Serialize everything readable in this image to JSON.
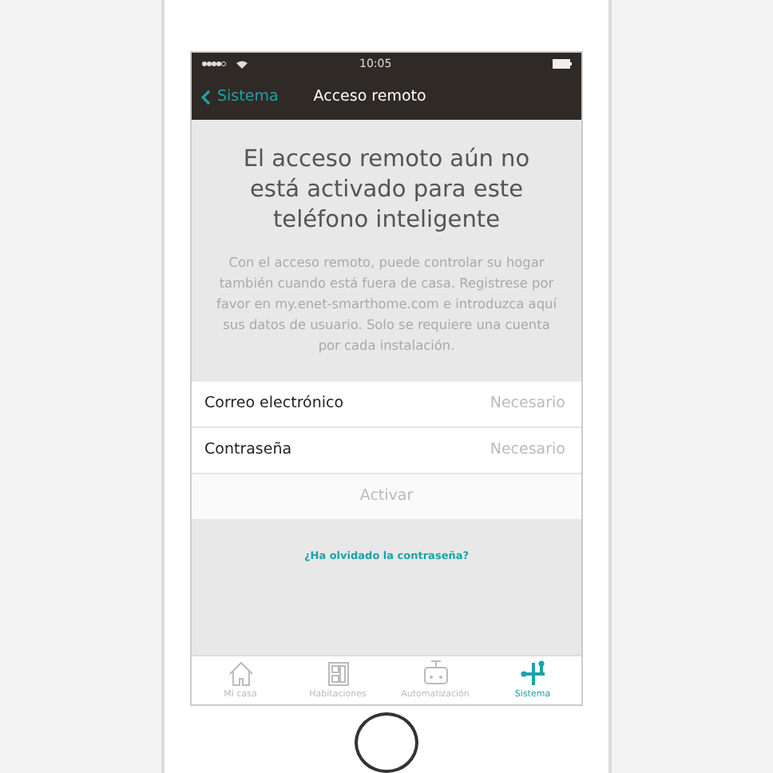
{
  "status_bar": {
    "time": "10:05"
  },
  "nav": {
    "back": "Sistema",
    "title": "Acceso remoto"
  },
  "heading": "El acceso remoto aún no está activado para este teléfono inteligente",
  "body": "Con el acceso remoto, puede controlar su hogar también cuando está fuera de casa. Registrese por favor en my.enet-smarthome.com e introduzca aquí sus datos de usuario. Solo se requiere una cuenta por cada instalación.",
  "fields": [
    {
      "label": "Correo electrónico",
      "placeholder": "Necesario"
    },
    {
      "label": "Contraseña",
      "placeholder": "Necesario"
    }
  ],
  "button": "Activar",
  "link": "¿Ha olvidado la contraseña?",
  "tabs": [
    {
      "kind": "home",
      "label": "Mi casa",
      "selected": false
    },
    {
      "kind": "rooms",
      "label": "Habitaciones",
      "selected": false
    },
    {
      "kind": "automation",
      "label": "Automatización",
      "selected": false
    },
    {
      "kind": "system",
      "label": "Sistema",
      "selected": true
    }
  ]
}
